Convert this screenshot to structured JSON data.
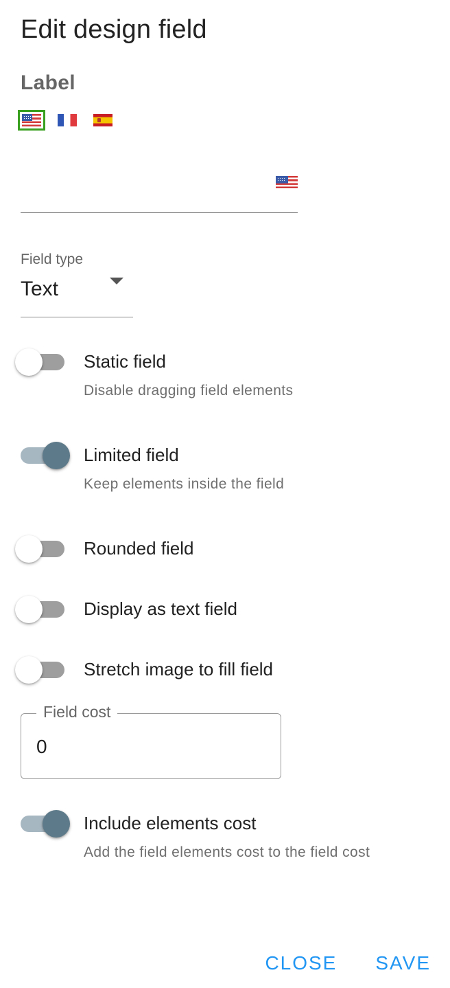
{
  "dialog": {
    "title": "Edit design field",
    "label_heading": "Label"
  },
  "languages": [
    {
      "code": "en",
      "icon": "us-flag-icon",
      "selected": true
    },
    {
      "code": "fr",
      "icon": "france-flag-icon",
      "selected": false
    },
    {
      "code": "es",
      "icon": "spain-flag-icon",
      "selected": false
    }
  ],
  "label_field": {
    "value": "",
    "adornment_icon": "us-flag-icon"
  },
  "field_type": {
    "label": "Field type",
    "value": "Text"
  },
  "switches": {
    "static_field": {
      "label": "Static field",
      "help": "Disable dragging field elements",
      "checked": false
    },
    "limited_field": {
      "label": "Limited field",
      "help": "Keep elements inside the field",
      "checked": true
    },
    "rounded_field": {
      "label": "Rounded field",
      "checked": false
    },
    "display_as_text": {
      "label": "Display as text field",
      "checked": false
    },
    "stretch_image": {
      "label": "Stretch image to fill field",
      "checked": false
    },
    "include_elements_cost": {
      "label": "Include elements cost",
      "help": "Add the field elements cost to the field cost",
      "checked": true
    }
  },
  "field_cost": {
    "label": "Field cost",
    "value": "0"
  },
  "actions": {
    "close_label": "CLOSE",
    "save_label": "SAVE"
  },
  "colors": {
    "accent_button": "#2196f3",
    "switch_on_thumb": "#5c7a89",
    "switch_on_track": "#a7b7c1",
    "selected_flag_border": "#3aa020"
  }
}
